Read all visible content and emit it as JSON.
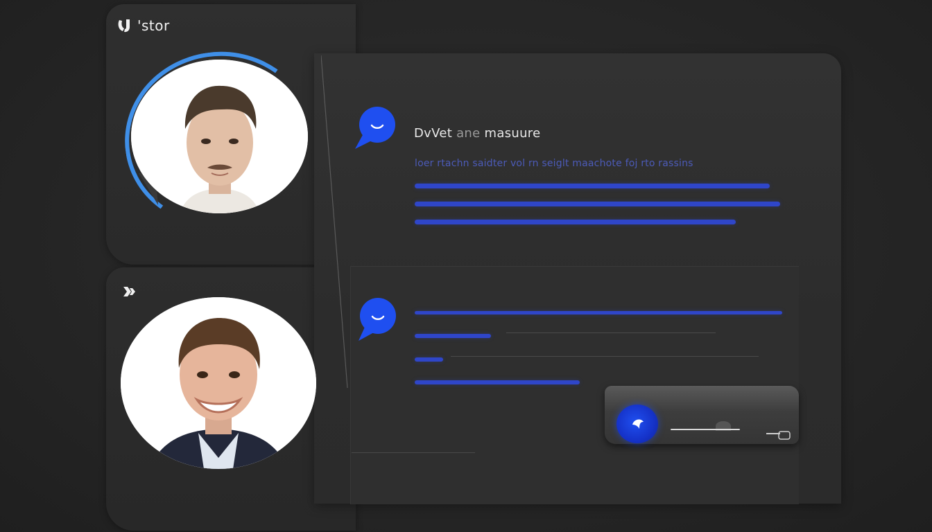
{
  "brand": {
    "name": "'stor"
  },
  "conversation_1": {
    "title_part_a": "DvVet",
    "title_part_b": "ane",
    "title_part_c": "masuure",
    "subtitle": "loer rtachn saidter vol rn seiglt maachote foj rto rassins"
  },
  "colors": {
    "accent_blue": "#2f46c9",
    "bubble_blue": "#1f4ff0",
    "ring_blue": "#3f8fe8",
    "background": "#262626"
  },
  "icons": {
    "brand": "brand-logo-icon",
    "bubble": "chat-bubble-smile-icon",
    "send": "send-icon",
    "secondary": "chevron-logo-icon"
  }
}
